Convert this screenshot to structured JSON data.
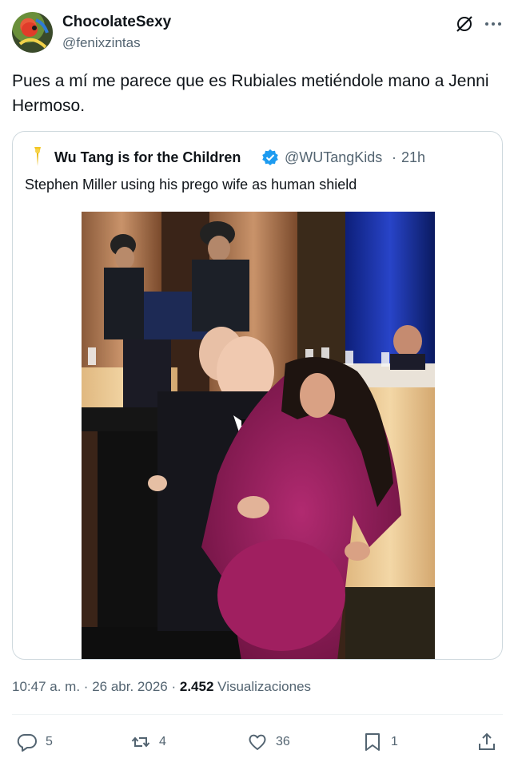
{
  "author": {
    "name": "ChocolateSexy",
    "handle": "@fenixzintas"
  },
  "tweet": {
    "text": "Pues a mí me parece que es Rubiales metiéndole mano a Jenni Hermoso."
  },
  "quoted": {
    "name": "Wu Tang is for the Children",
    "handle": "@WUTangKids",
    "separator": "·",
    "time": "21h",
    "text": "Stephen Miller using his prego wife as human shield",
    "verified": true
  },
  "meta": {
    "time": "10:47 a. m.",
    "sep1": "·",
    "date": "26 abr. 2026",
    "sep2": "·",
    "views_count": "2.452",
    "views_label": "Visualizaciones"
  },
  "actions": {
    "replies": "5",
    "reposts": "4",
    "likes": "36",
    "bookmarks": "1"
  },
  "colors": {
    "text": "#0f1419",
    "secondary": "#536471",
    "border": "#cfd9de",
    "verified": "#1d9bf0",
    "dress": "#9c1f5e"
  },
  "icons": [
    "grok-icon",
    "more-icon",
    "verified-icon",
    "reply-icon",
    "repost-icon",
    "like-icon",
    "bookmark-icon",
    "share-icon"
  ]
}
